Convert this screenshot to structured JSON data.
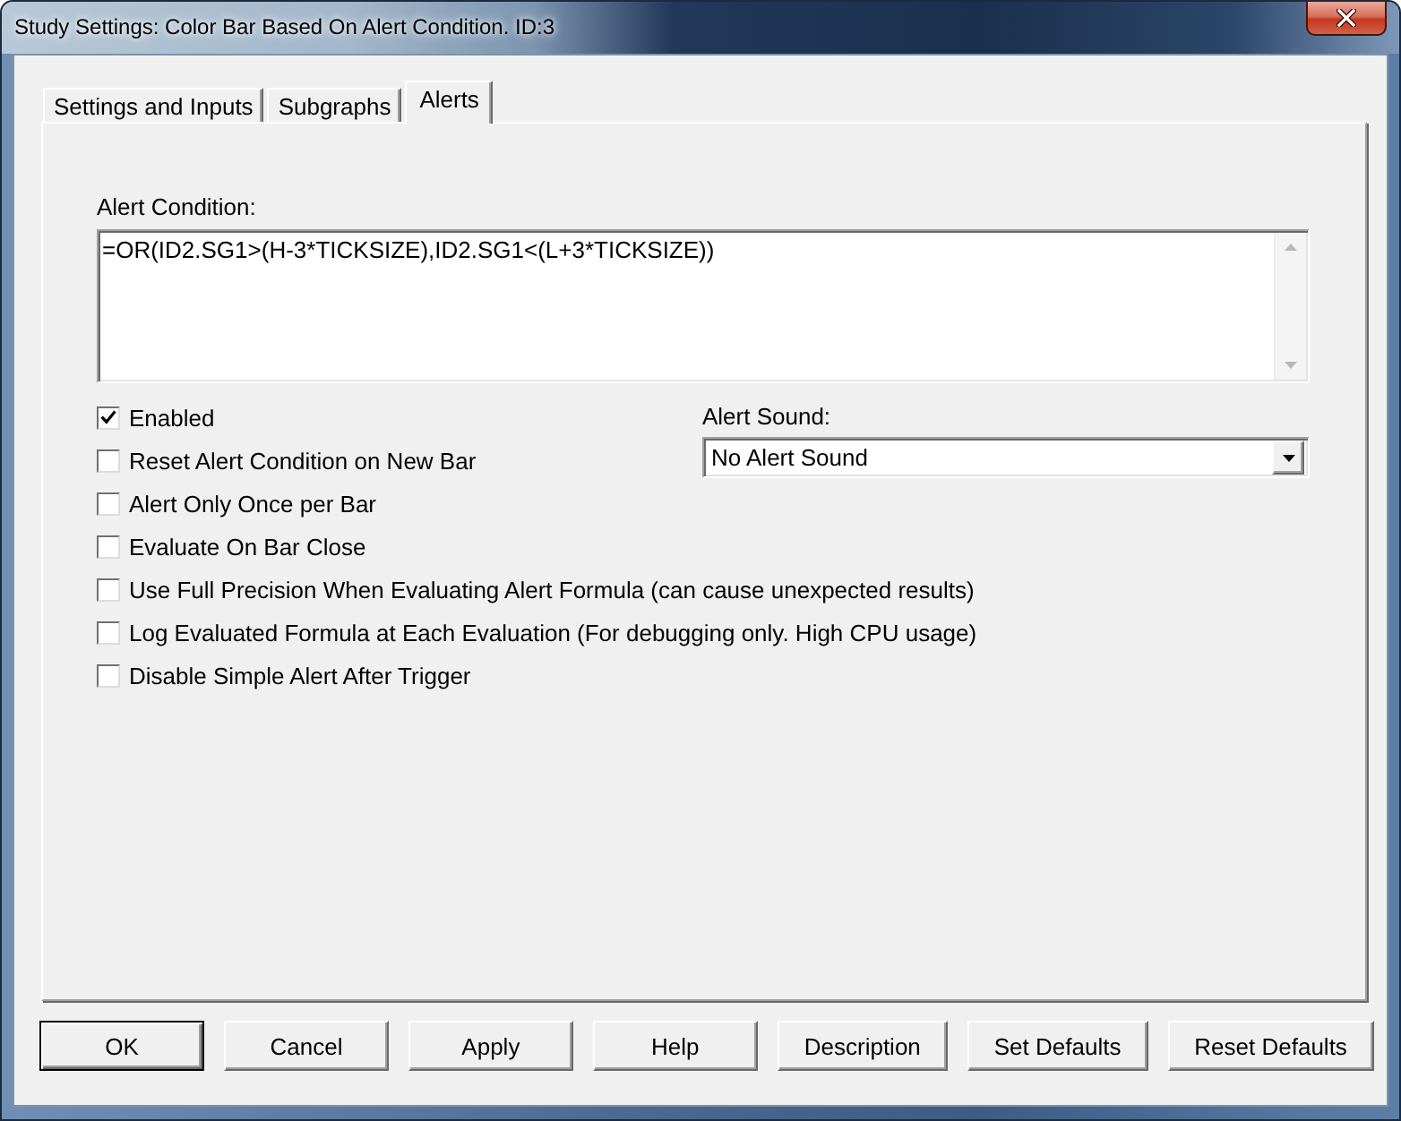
{
  "window": {
    "title": "Study Settings: Color Bar Based On Alert Condition. ID:3"
  },
  "tabs": [
    {
      "label": "Settings and Inputs",
      "selected": false
    },
    {
      "label": "Subgraphs",
      "selected": false
    },
    {
      "label": "Alerts",
      "selected": true
    }
  ],
  "alert_condition": {
    "label": "Alert Condition:",
    "value": "=OR(ID2.SG1>(H-3*TICKSIZE),ID2.SG1<(L+3*TICKSIZE))"
  },
  "options": [
    {
      "label": "Enabled",
      "checked": true
    },
    {
      "label": "Reset Alert Condition on New Bar",
      "checked": false
    },
    {
      "label": "Alert Only Once per Bar",
      "checked": false
    },
    {
      "label": "Evaluate On Bar Close",
      "checked": false
    },
    {
      "label": "Use Full Precision When Evaluating Alert Formula (can cause unexpected results)",
      "checked": false
    },
    {
      "label": "Log Evaluated Formula at Each Evaluation (For debugging only. High CPU usage)",
      "checked": false
    },
    {
      "label": "Disable Simple Alert After Trigger",
      "checked": false
    }
  ],
  "alert_sound": {
    "label": "Alert Sound:",
    "value": "No Alert Sound"
  },
  "buttons": [
    {
      "label": "OK",
      "default": true
    },
    {
      "label": "Cancel",
      "default": false
    },
    {
      "label": "Apply",
      "default": false
    },
    {
      "label": "Help",
      "default": false
    },
    {
      "label": "Description",
      "default": false
    },
    {
      "label": "Set Defaults",
      "default": false
    },
    {
      "label": "Reset Defaults",
      "default": false
    }
  ]
}
